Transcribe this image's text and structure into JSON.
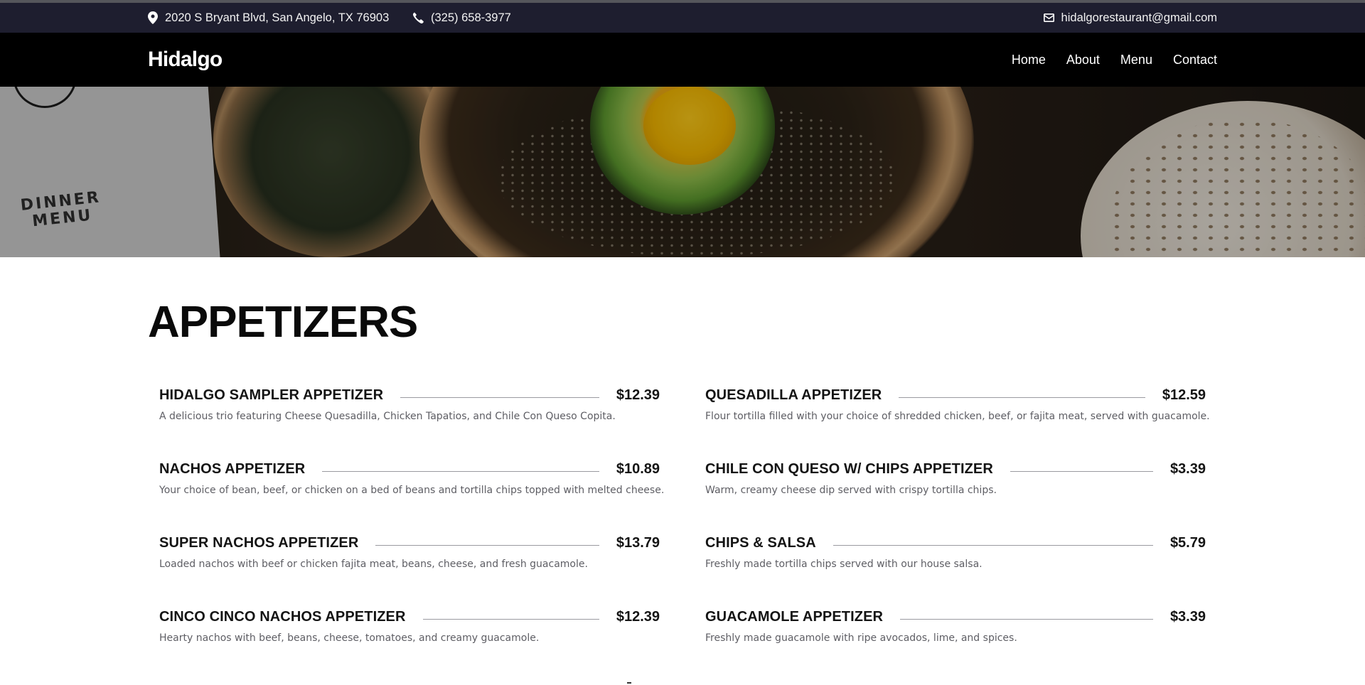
{
  "topbar": {
    "address": "2020 S Bryant Blvd, San Angelo, TX 76903",
    "phone": "(325) 658-3977",
    "email": "hidalgorestaurant@gmail.com"
  },
  "brand": {
    "logo": "Hidalgo"
  },
  "nav": [
    {
      "label": "Home"
    },
    {
      "label": "About"
    },
    {
      "label": "Menu"
    },
    {
      "label": "Contact"
    }
  ],
  "hero": {
    "menu_card_text_line1": "DINNER",
    "menu_card_text_line2": "MENU"
  },
  "section": {
    "title": "APPETIZERS"
  },
  "items": [
    {
      "name": "HIDALGO SAMPLER APPETIZER",
      "price": "$12.39",
      "description": "A delicious trio featuring Cheese Quesadilla, Chicken Tapatios, and Chile Con Queso Copita."
    },
    {
      "name": "QUESADILLA APPETIZER",
      "price": "$12.59",
      "description": "Flour tortilla filled with your choice of shredded chicken, beef, or fajita meat, served with guacamole."
    },
    {
      "name": "NACHOS APPETIZER",
      "price": "$10.89",
      "description": "Your choice of bean, beef, or chicken on a bed of beans and tortilla chips topped with melted cheese."
    },
    {
      "name": "CHILE CON QUESO W/ CHIPS APPETIZER",
      "price": "$3.39",
      "description": "Warm, creamy cheese dip served with crispy tortilla chips."
    },
    {
      "name": "SUPER NACHOS APPETIZER",
      "price": "$13.79",
      "description": "Loaded nachos with beef or chicken fajita meat, beans, cheese, and fresh guacamole."
    },
    {
      "name": "CHIPS & SALSA",
      "price": "$5.79",
      "description": "Freshly made tortilla chips served with our house salsa."
    },
    {
      "name": "CINCO CINCO NACHOS APPETIZER",
      "price": "$12.39",
      "description": "Hearty nachos with beef, beans, cheese, tomatoes, and creamy guacamole."
    },
    {
      "name": "GUACAMOLE APPETIZER",
      "price": "$3.39",
      "description": "Freshly made guacamole with ripe avocados, lime, and spices."
    }
  ]
}
